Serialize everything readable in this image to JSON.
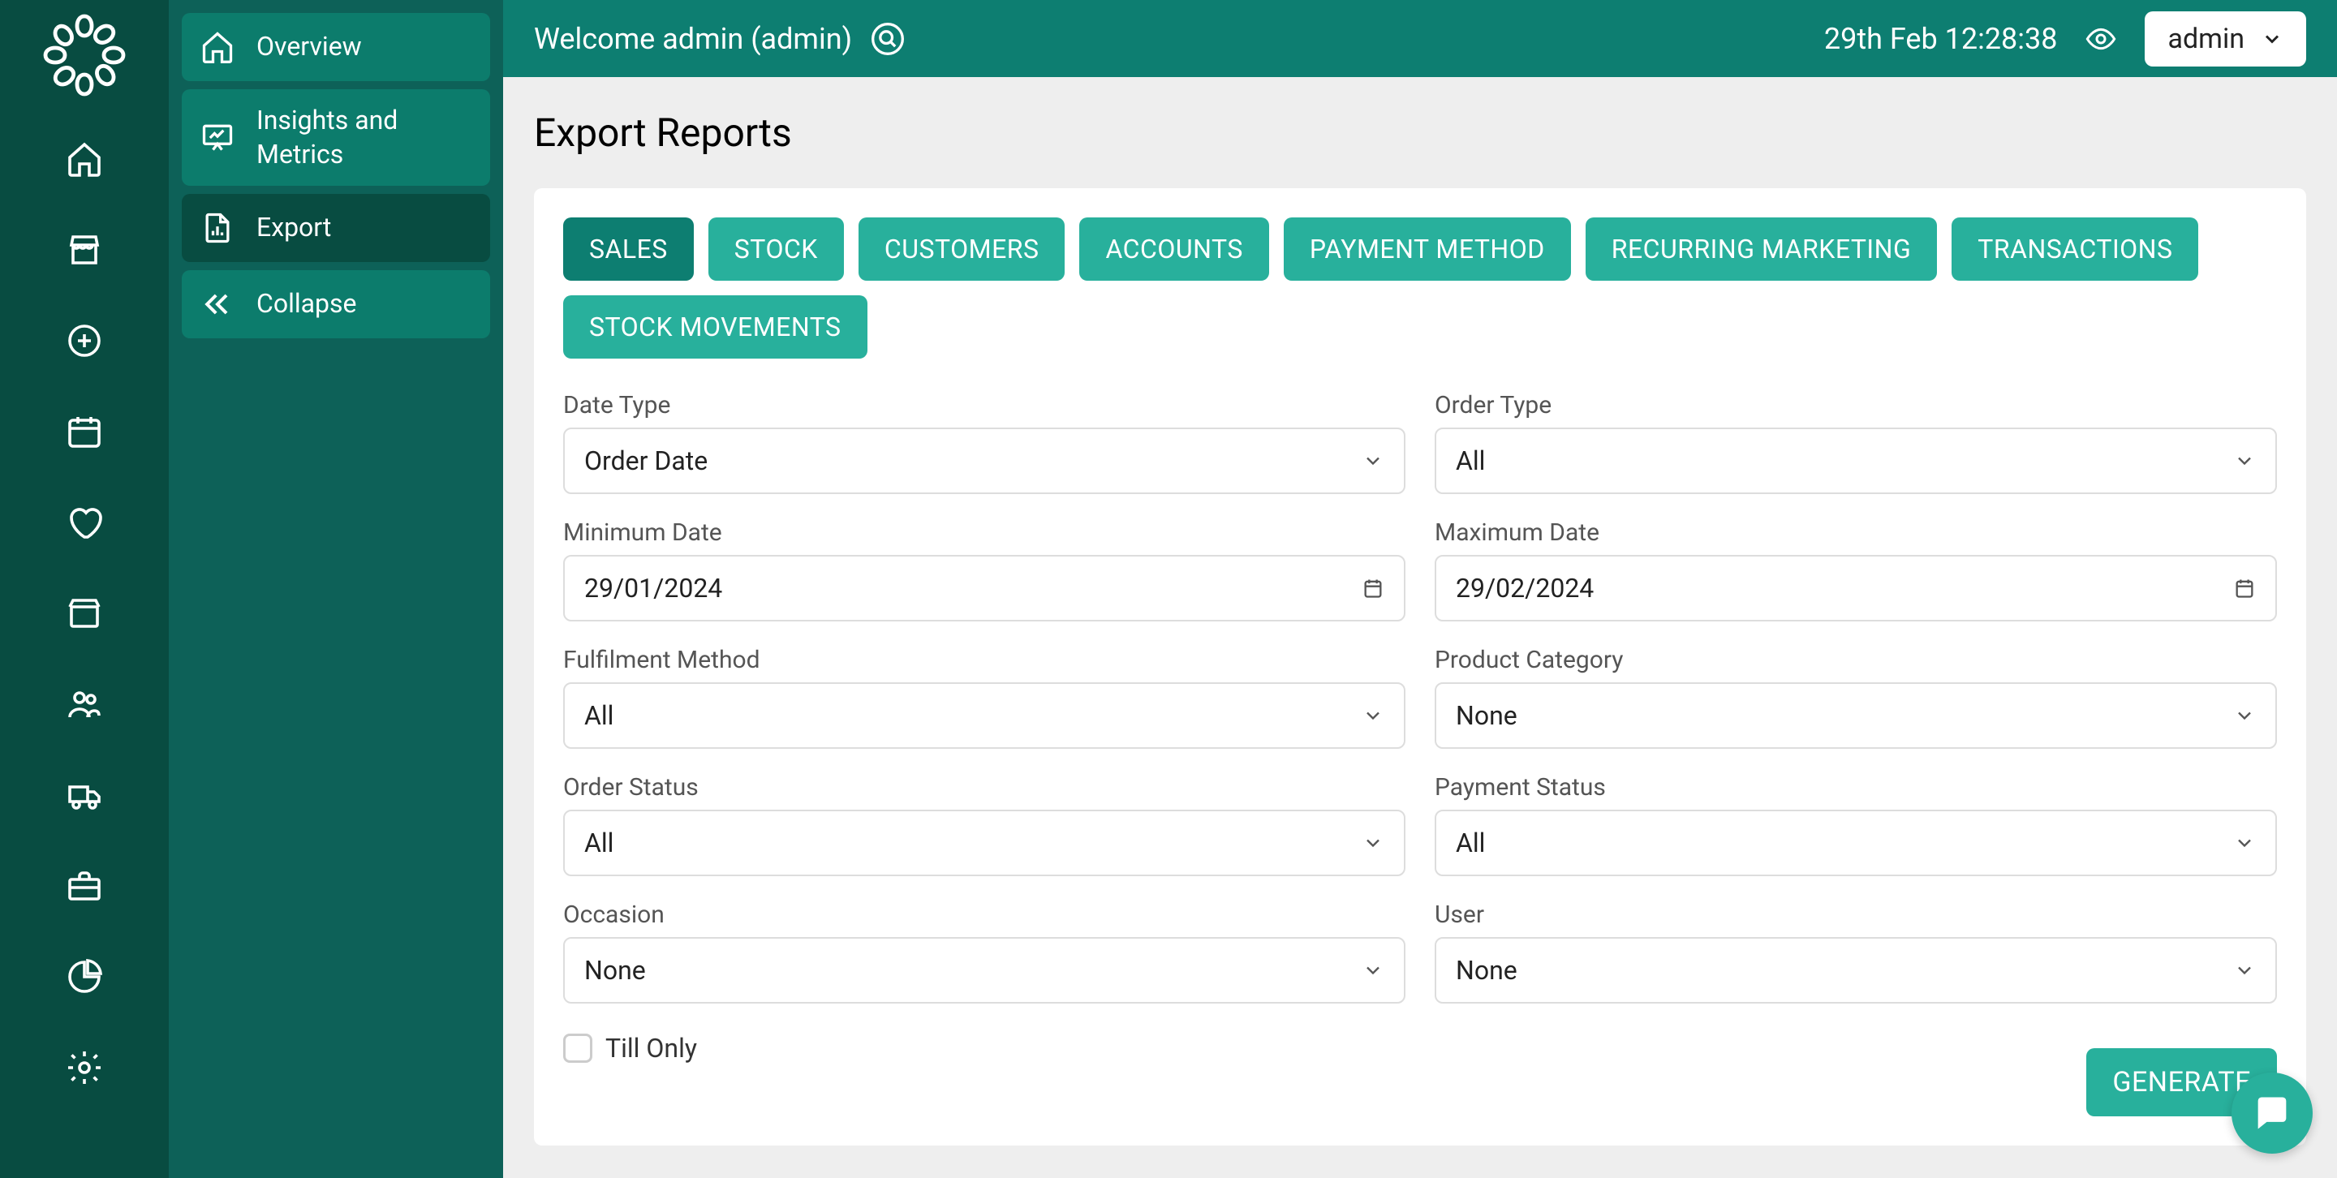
{
  "header": {
    "welcome": "Welcome admin (admin)",
    "datetime": "29th Feb 12:28:38",
    "user_label": "admin"
  },
  "sidebar_menu": {
    "items": [
      {
        "label": "Overview",
        "active": false
      },
      {
        "label": "Insights and\nMetrics",
        "active": false
      },
      {
        "label": "Export",
        "active": true
      },
      {
        "label": "Collapse",
        "active": false
      }
    ]
  },
  "page": {
    "title": "Export Reports"
  },
  "tabs": [
    {
      "label": "SALES",
      "active": true
    },
    {
      "label": "STOCK",
      "active": false
    },
    {
      "label": "CUSTOMERS",
      "active": false
    },
    {
      "label": "ACCOUNTS",
      "active": false
    },
    {
      "label": "PAYMENT METHOD",
      "active": false
    },
    {
      "label": "RECURRING MARKETING",
      "active": false
    },
    {
      "label": "TRANSACTIONS",
      "active": false
    },
    {
      "label": "STOCK MOVEMENTS",
      "active": false
    }
  ],
  "form": {
    "date_type": {
      "label": "Date Type",
      "value": "Order Date"
    },
    "order_type": {
      "label": "Order Type",
      "value": "All"
    },
    "min_date": {
      "label": "Minimum Date",
      "value": "29/01/2024"
    },
    "max_date": {
      "label": "Maximum Date",
      "value": "29/02/2024"
    },
    "fulfilment_method": {
      "label": "Fulfilment Method",
      "value": "All"
    },
    "product_category": {
      "label": "Product Category",
      "value": "None"
    },
    "order_status": {
      "label": "Order Status",
      "value": "All"
    },
    "payment_status": {
      "label": "Payment Status",
      "value": "All"
    },
    "occasion": {
      "label": "Occasion",
      "value": "None"
    },
    "user": {
      "label": "User",
      "value": "None"
    },
    "till_only_label": "Till Only",
    "generate_label": "GENERATE"
  }
}
